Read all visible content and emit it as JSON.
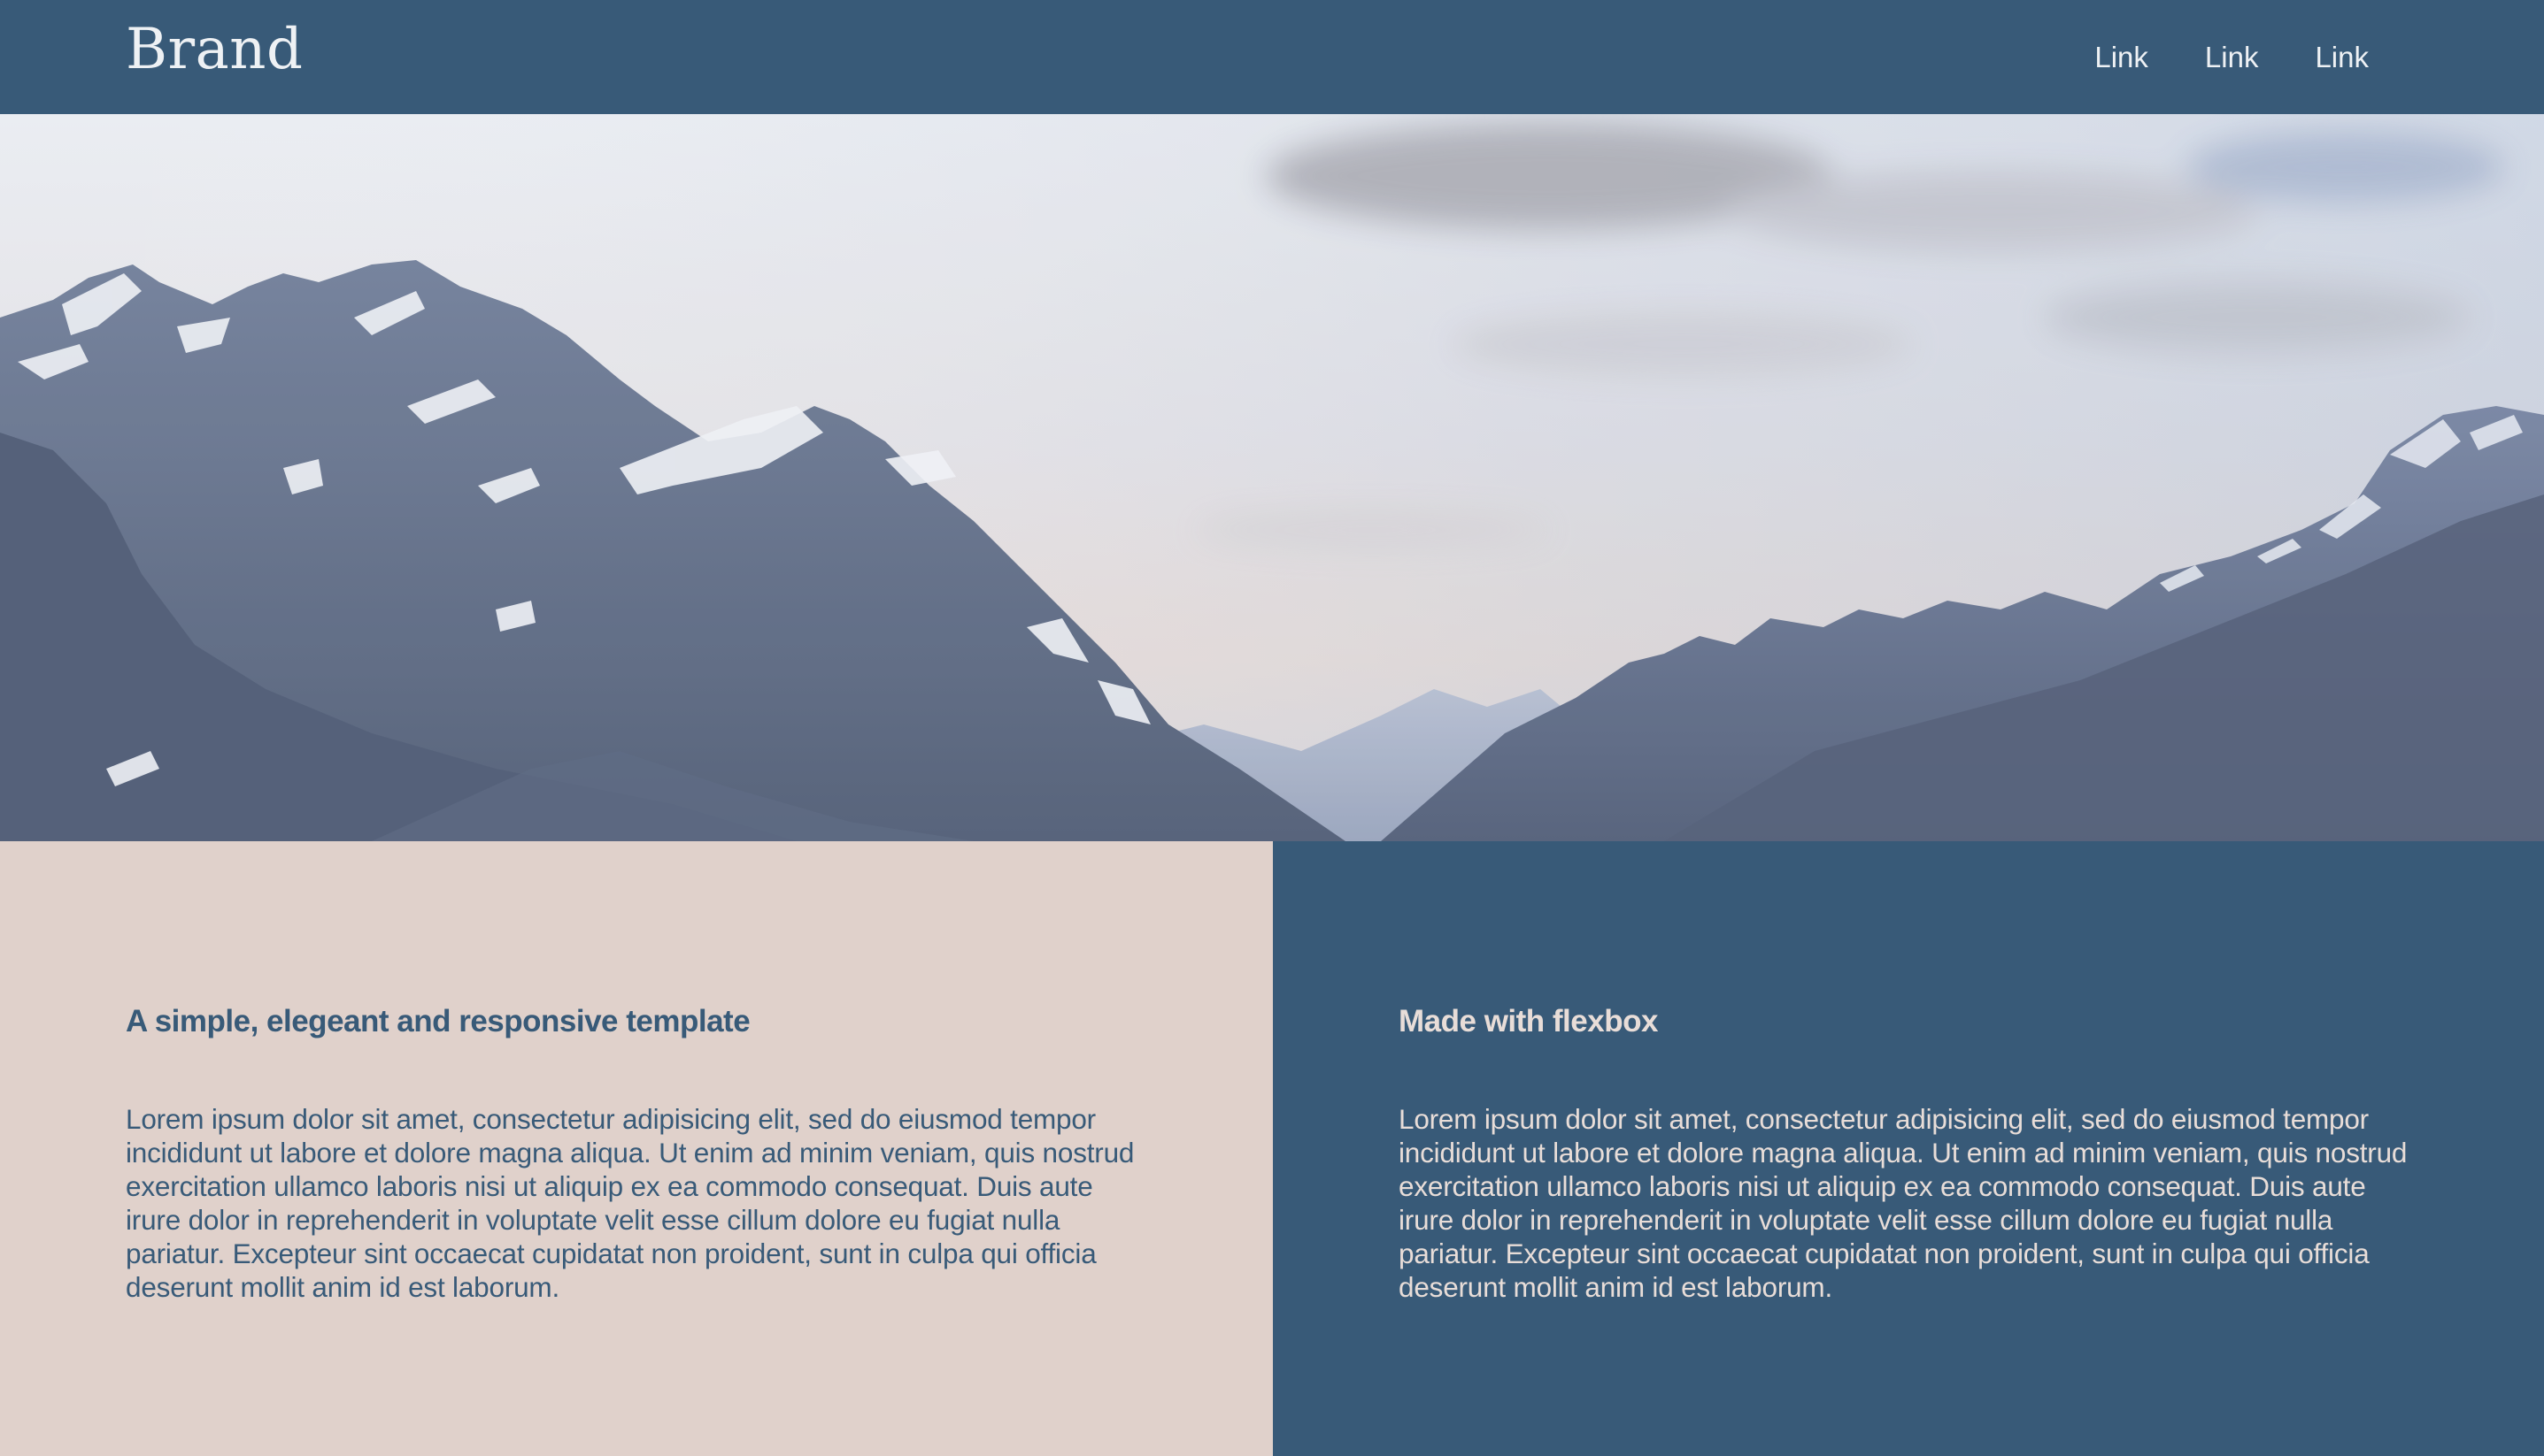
{
  "navbar": {
    "brand": "Brand",
    "links": [
      "Link",
      "Link",
      "Link"
    ]
  },
  "hero": {
    "image": "mountain-valley-landscape"
  },
  "sections": [
    {
      "heading": "A simple, elegeant and responsive template",
      "body": "Lorem ipsum dolor sit amet, consectetur adipisicing elit, sed do eiusmod tempor incididunt ut labore et dolore magna aliqua. Ut enim ad minim veniam, quis nostrud exercitation ullamco laboris nisi ut aliquip ex ea commodo consequat. Duis aute irure dolor in reprehenderit in voluptate velit esse cillum dolore eu fugiat nulla pariatur. Excepteur sint occaecat cupidatat non proident, sunt in culpa qui officia deserunt mollit anim id est laborum."
    },
    {
      "heading": "Made with flexbox",
      "body": "Lorem ipsum dolor sit amet, consectetur adipisicing elit, sed do eiusmod tempor incididunt ut labore et dolore magna aliqua. Ut enim ad minim veniam, quis nostrud exercitation ullamco laboris nisi ut aliquip ex ea commodo consequat. Duis aute irure dolor in reprehenderit in voluptate velit esse cillum dolore eu fugiat nulla pariatur. Excepteur sint occaecat cupidatat non proident, sunt in culpa qui officia deserunt mollit anim id est laborum."
    }
  ],
  "colors": {
    "primary": "#385a78",
    "secondary": "#e0d1cb",
    "text_light": "#eef1f4"
  }
}
